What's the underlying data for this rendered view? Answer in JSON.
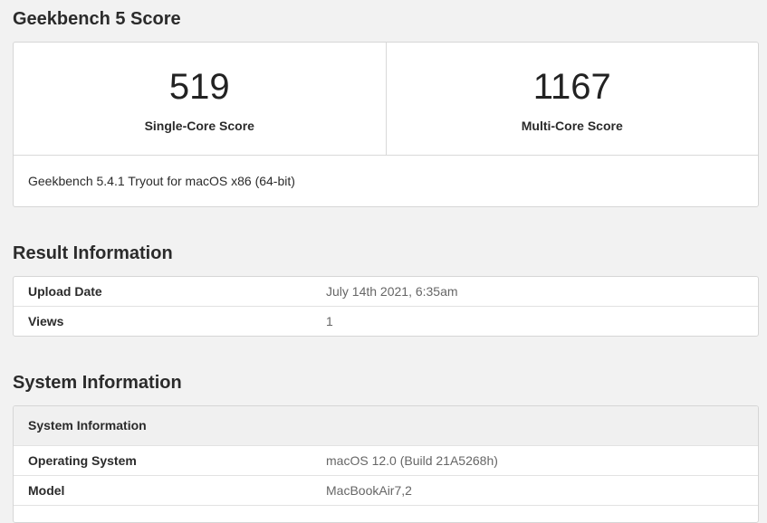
{
  "score_section": {
    "title": "Geekbench 5 Score",
    "single_core_value": "519",
    "single_core_label": "Single-Core Score",
    "multi_core_value": "1167",
    "multi_core_label": "Multi-Core Score",
    "version": "Geekbench 5.4.1 Tryout for macOS x86 (64-bit)"
  },
  "result_section": {
    "title": "Result Information",
    "rows": [
      {
        "key": "Upload Date",
        "value": "July 14th 2021, 6:35am"
      },
      {
        "key": "Views",
        "value": "1"
      }
    ]
  },
  "system_section": {
    "title": "System Information",
    "header": "System Information",
    "rows": [
      {
        "key": "Operating System",
        "value": "macOS 12.0 (Build 21A5268h)"
      },
      {
        "key": "Model",
        "value": "MacBookAir7,2"
      }
    ]
  }
}
